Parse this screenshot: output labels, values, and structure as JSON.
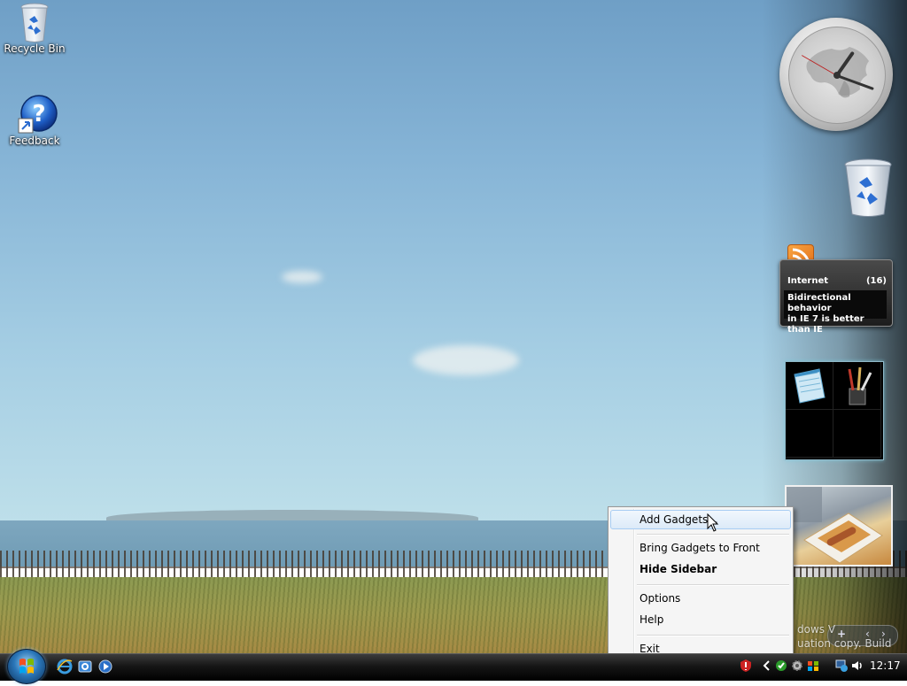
{
  "desktop": {
    "icons": [
      {
        "label": "Recycle Bin",
        "icon": "recycle-bin-icon"
      },
      {
        "label": "Feedback",
        "icon": "help-feedback-icon"
      }
    ]
  },
  "sidebar": {
    "feed": {
      "source": "Internet",
      "count": "(16)",
      "headline_line1": "Bidirectional behavior",
      "headline_line2": "in IE 7 is better than IE"
    },
    "watermark_line1": "dows V",
    "watermark_line2": "uation copy. Build"
  },
  "context_menu": {
    "items": [
      {
        "label": "Add Gadgets...",
        "highlighted": true
      },
      {
        "label": "Bring Gadgets to Front"
      },
      {
        "label": "Hide Sidebar",
        "bold": true
      },
      {
        "label": "Options"
      },
      {
        "label": "Help"
      },
      {
        "label": "Exit"
      }
    ]
  },
  "taskbar": {
    "time": "12:17"
  },
  "colors": {
    "menu_highlight": "#dceaf8",
    "taskbar": "#161616",
    "rss_orange": "#f29330"
  }
}
